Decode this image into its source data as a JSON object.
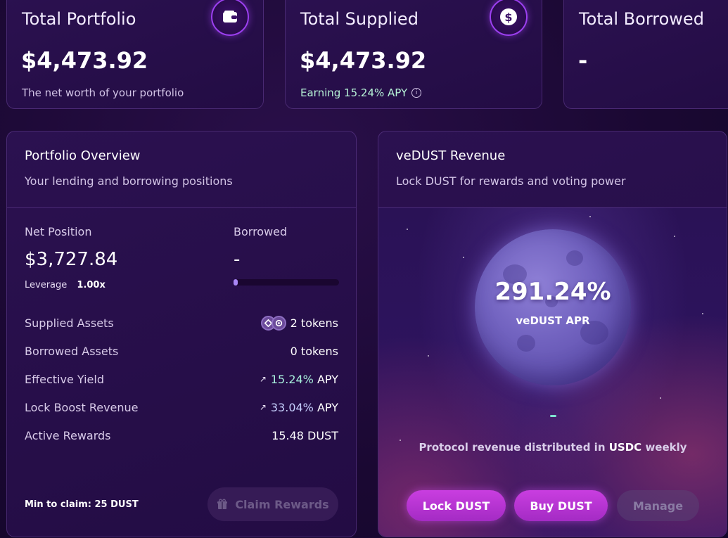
{
  "stats": {
    "portfolio": {
      "title": "Total Portfolio",
      "value": "$4,473.92",
      "sub": "The net worth of your portfolio",
      "icon": "wallet-icon"
    },
    "supplied": {
      "title": "Total Supplied",
      "value": "$4,473.92",
      "sub": "Earning 15.24% APY",
      "icon": "dollar-icon"
    },
    "borrowed": {
      "title": "Total Borrowed",
      "value": "-"
    }
  },
  "overview": {
    "title": "Portfolio Overview",
    "subtitle": "Your lending and borrowing positions",
    "net_position_label": "Net Position",
    "net_position_value": "$3,727.84",
    "leverage_label": "Leverage",
    "leverage_value": "1.00x",
    "borrowed_label": "Borrowed",
    "borrowed_value": "-",
    "borrowed_progress": 0,
    "rows": [
      {
        "label": "Supplied Assets",
        "value": "2 tokens"
      },
      {
        "label": "Borrowed Assets",
        "value": "0 tokens"
      },
      {
        "label": "Effective Yield",
        "value": "15.24%",
        "unit": "APY"
      },
      {
        "label": "Lock Boost Revenue",
        "value": "33.04%",
        "unit": "APY"
      },
      {
        "label": "Active Rewards",
        "value": "15.48 DUST"
      }
    ],
    "min_claim": "Min to claim: 25 DUST",
    "claim_button": "Claim Rewards"
  },
  "vedust": {
    "title": "veDUST Revenue",
    "subtitle": "Lock DUST for rewards and voting power",
    "apr_value": "291.24%",
    "apr_label": "veDUST APR",
    "status_value": "-",
    "protocol_prefix": "Protocol revenue distributed in",
    "protocol_token": "USDC",
    "protocol_suffix": "weekly",
    "buttons": {
      "lock": "Lock DUST",
      "buy": "Buy DUST",
      "manage": "Manage"
    }
  },
  "colors": {
    "accent": "#a42bc4",
    "teal": "#a8f0dc",
    "lavender": "#c7d2ff",
    "bg": "#1a0832"
  }
}
